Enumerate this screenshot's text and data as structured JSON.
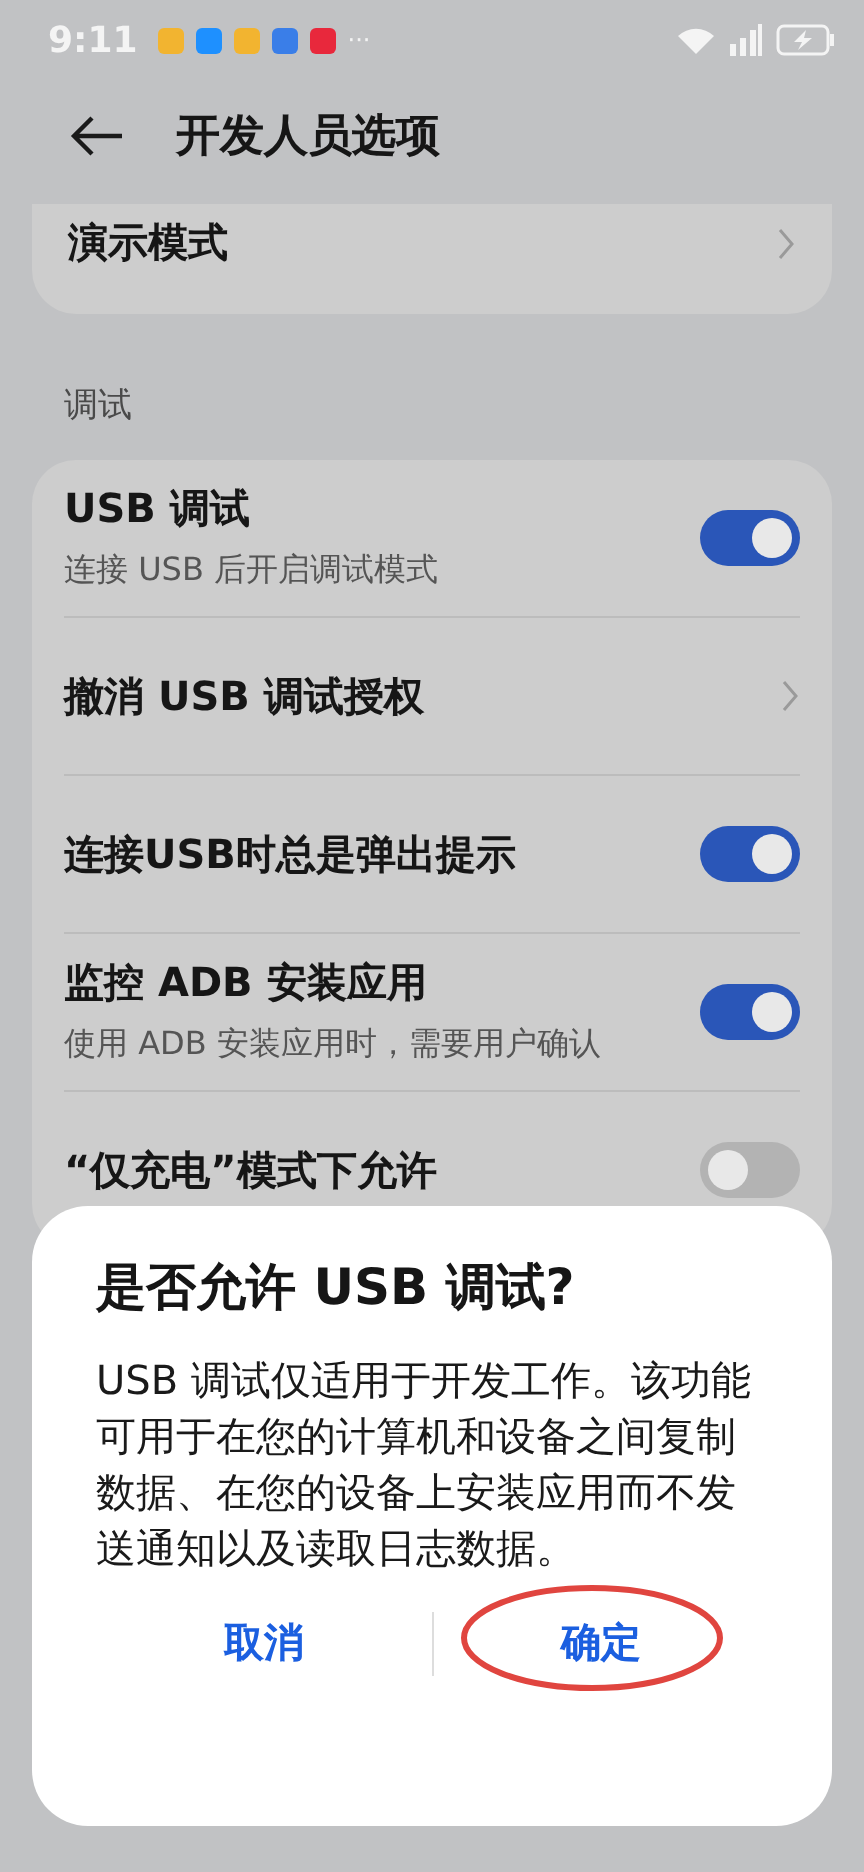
{
  "status_bar": {
    "time": "9:11",
    "more": "···"
  },
  "header": {
    "title": "开发人员选项"
  },
  "top_card": {
    "label": "演示模式"
  },
  "section": {
    "label": "调试"
  },
  "rows": [
    {
      "kind": "toggle",
      "title": "USB 调试",
      "subtitle": "连接 USB 后开启调试模式",
      "on": true
    },
    {
      "kind": "link",
      "title": "撤消 USB 调试授权"
    },
    {
      "kind": "toggle",
      "title": "连接USB时总是弹出提示",
      "on": true
    },
    {
      "kind": "toggle",
      "title": "监控 ADB 安装应用",
      "subtitle": "使用 ADB 安装应用时，需要用户确认",
      "on": true
    },
    {
      "kind": "toggle",
      "title": "“仅充电”模式下允许",
      "on": false
    }
  ],
  "dialog": {
    "title": "是否允许 USB 调试?",
    "message": "USB 调试仅适用于开发工作。该功能可用于在您的计算机和设备之间复制数据、在您的设备上安装应用而不发送通知以及读取日志数据。",
    "buttons": [
      {
        "label": "取消",
        "circled": false
      },
      {
        "label": "确定",
        "circled": true
      }
    ]
  }
}
